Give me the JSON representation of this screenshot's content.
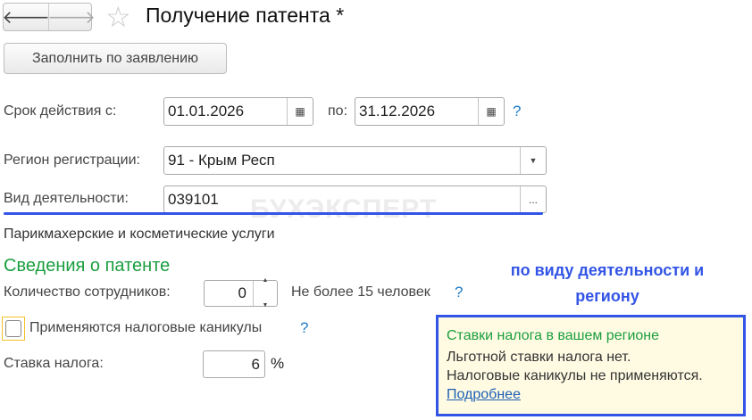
{
  "header": {
    "back_icon": "arrow-left-icon",
    "forward_icon": "arrow-right-icon",
    "favorite_icon": "star-icon",
    "title": "Получение патента *"
  },
  "fill_button": "Заполнить по заявлению",
  "period": {
    "label": "Срок действия с:",
    "from": "01.01.2026",
    "to_label": "по:",
    "to": "31.12.2026",
    "help": "?"
  },
  "region": {
    "label": "Регион регистрации:",
    "value": "91 - Крым Респ"
  },
  "activity": {
    "label": "Вид деятельности:",
    "value": "039101",
    "select": "...",
    "description": "Парикмахерские и косметические услуги"
  },
  "watermark": "БУХЭКСПЕРТ",
  "section_title": "Сведения о патенте",
  "annotation": {
    "line1": "по виду деятельности и",
    "line2": "региону"
  },
  "employees": {
    "label": "Количество сотрудников:",
    "value": "0",
    "hint": "Не более 15 человек",
    "help": "?"
  },
  "holidays": {
    "label": "Применяются налоговые каникулы",
    "checked": false,
    "help": "?"
  },
  "rate": {
    "label": "Ставка налога:",
    "value": "6",
    "unit": "%"
  },
  "info": {
    "title": "Ставки налога в вашем регионе",
    "line1": "Льготной ставки налога нет.",
    "line2": "Налоговые каникулы не применяются.",
    "link": "Подробнее"
  },
  "colors": {
    "green": "#1a9e3f",
    "blue": "#3355e6",
    "box_bg": "#fffbe3"
  }
}
